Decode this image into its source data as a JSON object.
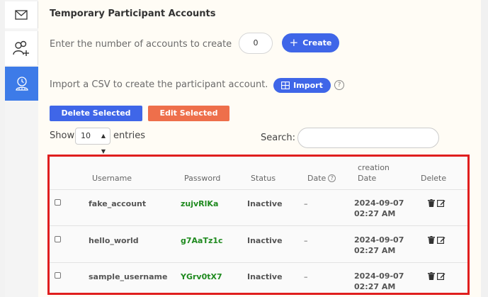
{
  "sidebar": {
    "items": [
      {
        "name": "mail",
        "icon": "mail-icon"
      },
      {
        "name": "participants",
        "icon": "users-plus-icon"
      },
      {
        "name": "temporary-accounts",
        "icon": "user-clock-icon",
        "active": true
      }
    ]
  },
  "page": {
    "title": "Temporary Participant Accounts",
    "create_label": "Enter the number of accounts to create",
    "create_count": "0",
    "create_button": "Create",
    "import_label": "Import a CSV to create the participant account.",
    "import_button": "Import",
    "help_icon": "?",
    "delete_selected": "Delete Selected",
    "edit_selected": "Edit Selected",
    "show_label": "Show",
    "entries_value": "10",
    "entries_label": "entries",
    "search_label": "Search:",
    "search_value": ""
  },
  "table": {
    "headers": {
      "username": "Username",
      "password": "Password",
      "status": "Status",
      "date": "Date",
      "creation_date_1": "creation",
      "creation_date_2": "Date",
      "delete": "Delete"
    },
    "rows": [
      {
        "username": "fake_account",
        "password": "zujvRlKa",
        "status": "Inactive",
        "date": "–",
        "created_date": "2024-09-07",
        "created_time": "02:27 AM"
      },
      {
        "username": "hello_world",
        "password": "g7AaTz1c",
        "status": "Inactive",
        "date": "–",
        "created_date": "2024-09-07",
        "created_time": "02:27 AM"
      },
      {
        "username": "sample_username",
        "password": "YGrv0tX7",
        "status": "Inactive",
        "date": "–",
        "created_date": "2024-09-07",
        "created_time": "02:27 AM"
      }
    ]
  },
  "colors": {
    "primary": "#3f66e8",
    "danger": "#ee6f4b",
    "highlight_border": "#e01e1e",
    "password_text": "#1f8a1f",
    "active_rail": "#3d7be8"
  }
}
